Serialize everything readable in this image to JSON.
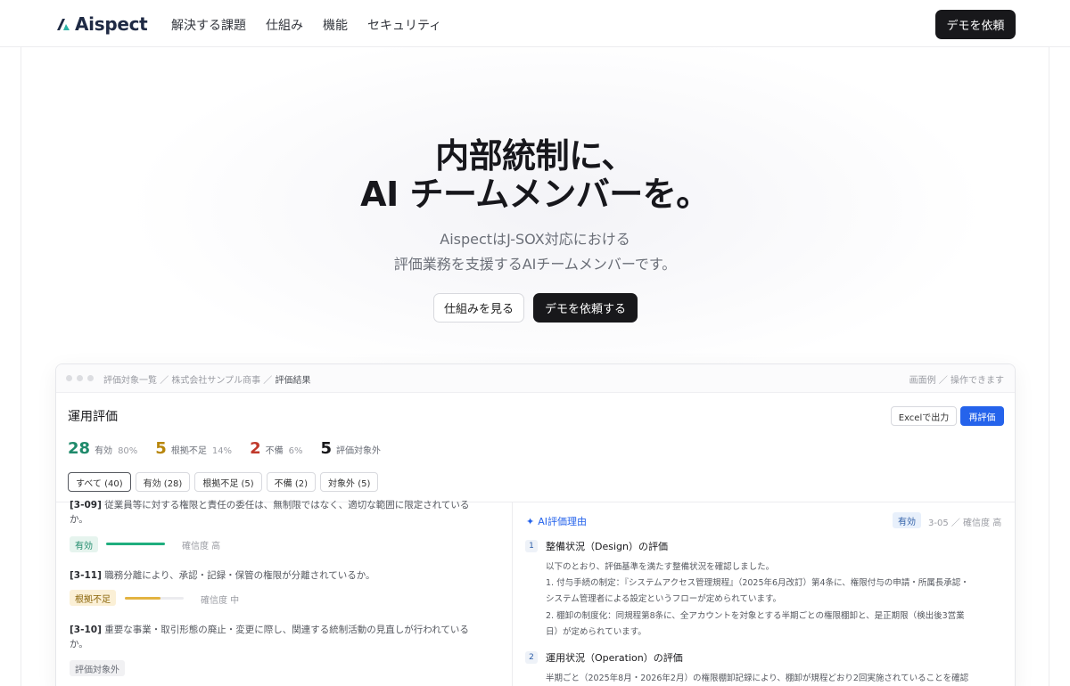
{
  "nav": {
    "brand": "Aispect",
    "links": [
      "解決する課題",
      "仕組み",
      "機能",
      "セキュリティ"
    ],
    "cta": "デモを依頼"
  },
  "hero": {
    "title_line1": "内部統制に、",
    "title_line2": "AI チームメンバーを。",
    "subtitle_line1": "AispectはJ-SOX対応における",
    "subtitle_line2": "評価業務を支援するAIチームメンバーです。",
    "secondary_button": "仕組みを見る",
    "primary_button": "デモを依頼する"
  },
  "app": {
    "breadcrumb": [
      "評価対象一覧",
      "株式会社サンプル商事",
      "評価結果"
    ],
    "breadcrumb_sep": "／",
    "chrome_note": "画面例 ／ 操作できます",
    "section_title": "運用評価",
    "excel_button": "Excelで出力",
    "reeval_button": "再評価",
    "stats": [
      {
        "num": "28",
        "label": "有効",
        "pct": "80%",
        "color": "#1f8a6b"
      },
      {
        "num": "5",
        "label": "根拠不足",
        "pct": "14%",
        "color": "#b8860b"
      },
      {
        "num": "2",
        "label": "不備",
        "pct": "6%",
        "color": "#c0392b"
      },
      {
        "num": "5",
        "label": "評価対象外",
        "pct": "",
        "color": "#18181b"
      }
    ],
    "filters": [
      "すべて (40)",
      "有効 (28)",
      "根拠不足 (5)",
      "不備 (2)",
      "対象外 (5)"
    ],
    "items": [
      {
        "code": "[3-09]",
        "text": "従業員等に対する権限と責任の委任は、無制限ではなく、適切な範囲に限定されているか。",
        "status": "有効",
        "level": 1.0,
        "conf": "確信度 高"
      },
      {
        "code": "[3-11]",
        "text": "職務分離により、承認・記録・保管の権限が分離されているか。",
        "status": "根拠不足",
        "level": 0.6,
        "conf": "確信度 中"
      },
      {
        "code": "[3-10]",
        "text": "重要な事業・取引形態の廃止・変更に際し、関連する統制活動の見直しが行われているか。",
        "status": "評価対象外"
      }
    ],
    "ai": {
      "title": "AI評価理由",
      "badge": "有効",
      "meta": "3-05 ／ 確信度 高",
      "steps": [
        {
          "num": "1",
          "title": "整備状況（Design）の評価",
          "lines": [
            "以下のとおり、評価基準を満たす整備状況を確認しました。",
            "1. 付与手続の制定：『システムアクセス管理規程』（2025年6月改訂）第4条に、権限付与の申請・所属長承認・",
            "システム管理者による設定というフローが定められています。",
            "2. 棚卸の制度化：同規程第8条に、全アカウントを対象とする半期ごとの権限棚卸と、是正期限（検出後3営業",
            "日）が定められています。"
          ]
        },
        {
          "num": "2",
          "title": "運用状況（Operation）の評価",
          "lines": [
            "半期ごと（2025年8月・2026年2月）の権限棚卸記録により、棚卸が規程どおり2回実施されていることを確認"
          ]
        }
      ]
    }
  }
}
